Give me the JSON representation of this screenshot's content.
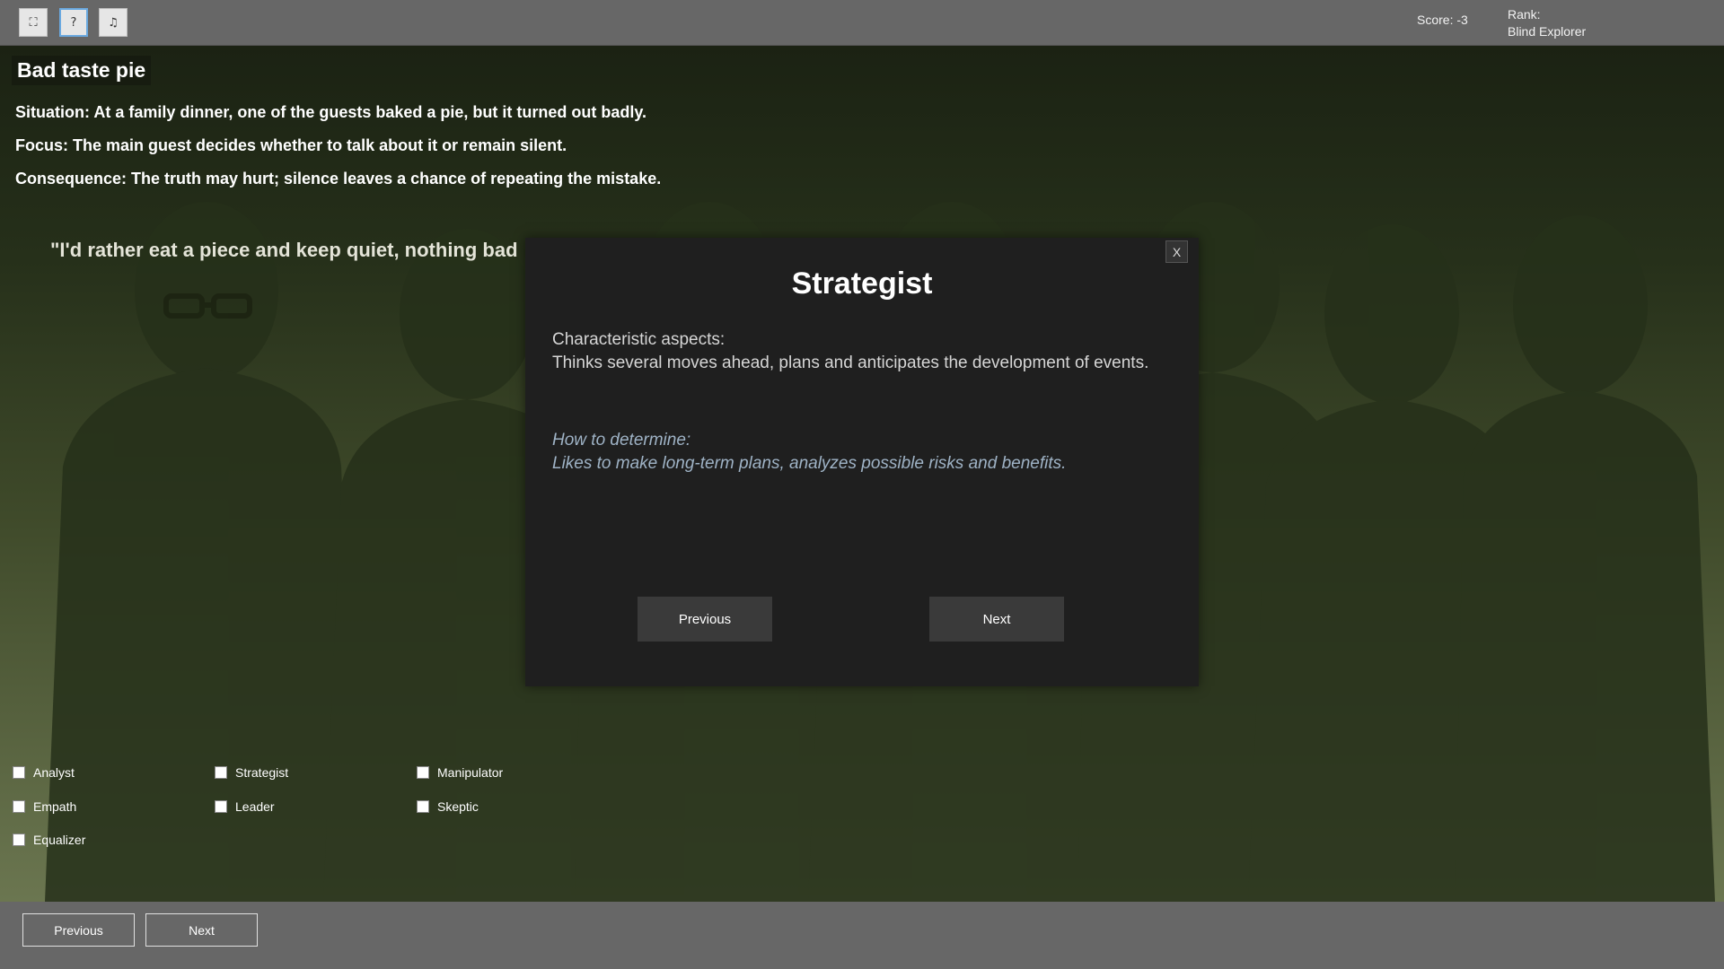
{
  "toolbar": {
    "fullscreen_glyph": "⛶",
    "help_glyph": "?",
    "music_glyph": "♫"
  },
  "status": {
    "score": "Score: -3",
    "rank_label": "Rank:",
    "rank_value": "Blind Explorer"
  },
  "scenario": {
    "title": "Bad taste pie",
    "situation": "Situation: At a family dinner, one of the guests baked a pie, but it turned out badly.",
    "focus": "Focus: The main guest decides whether to talk about it or remain silent.",
    "consequence": "Consequence: The truth may hurt; silence leaves a chance of repeating the mistake.",
    "quote": "\"I'd rather eat a piece and keep quiet, nothing bad"
  },
  "options": [
    {
      "label": "Analyst"
    },
    {
      "label": "Strategist"
    },
    {
      "label": "Manipulator"
    },
    {
      "label": "Empath"
    },
    {
      "label": "Leader"
    },
    {
      "label": "Skeptic"
    },
    {
      "label": "Equalizer"
    }
  ],
  "bottom": {
    "previous_label": "Previous",
    "next_label": "Next"
  },
  "modal": {
    "close_label": "X",
    "title": "Strategist",
    "aspects_label": "Characteristic aspects:",
    "aspects_text": "Thinks several moves ahead, plans and anticipates the development of events.",
    "how_label": "How to determine:",
    "how_text": "Likes to make long-term plans, analyzes possible risks and benefits.",
    "previous_label": "Previous",
    "next_label": "Next"
  },
  "colors": {
    "topbar": "#676767",
    "modal_bg": "#1f1f1f",
    "italic_text": "#9fb3c6",
    "accent_border": "#6aa9e0"
  },
  "icons": [
    "fullscreen-icon",
    "help-icon",
    "music-icon",
    "close-icon"
  ]
}
